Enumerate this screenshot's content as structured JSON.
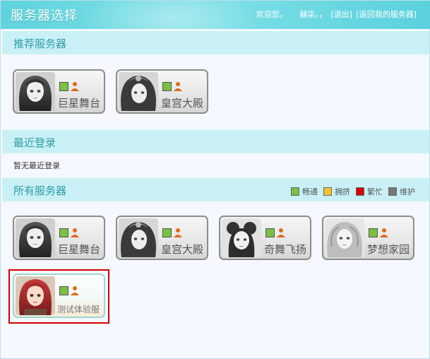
{
  "header": {
    "title": "服务器选择",
    "welcome": "欢迎您，",
    "username": "囍柒。，",
    "logout": "[退出]",
    "back": "[返回我的服务器]"
  },
  "sections": {
    "recommended": "推荐服务器",
    "recent": "最近登录",
    "all": "所有服务器"
  },
  "recent_empty": "暂无最近登录",
  "legend": [
    {
      "label": "畅通",
      "color": "#7ac142"
    },
    {
      "label": "拥挤",
      "color": "#f5c231"
    },
    {
      "label": "繁忙",
      "color": "#d60000"
    },
    {
      "label": "维护",
      "color": "#777777"
    }
  ],
  "recommended_servers": [
    {
      "name": "巨星舞台",
      "status": "畅通",
      "icon": "person-icon"
    },
    {
      "name": "皇宫大殿",
      "status": "畅通",
      "icon": "person-icon"
    }
  ],
  "all_servers": [
    {
      "name": "巨星舞台",
      "status": "畅通",
      "icon": "person-icon"
    },
    {
      "name": "皇宫大殿",
      "status": "畅通",
      "icon": "person-icon"
    },
    {
      "name": "奇舞飞扬",
      "status": "畅通",
      "icon": "person-icon"
    },
    {
      "name": "梦想家园",
      "status": "畅通",
      "icon": "person-icon"
    },
    {
      "name": "测试体验服",
      "status": "畅通",
      "icon": "person-icon",
      "selected": true
    }
  ],
  "colors": {
    "header": "#5fd3dd",
    "section": "#c9f1f5",
    "section_text": "#2f9aa8",
    "selection_frame": "#d10000"
  }
}
